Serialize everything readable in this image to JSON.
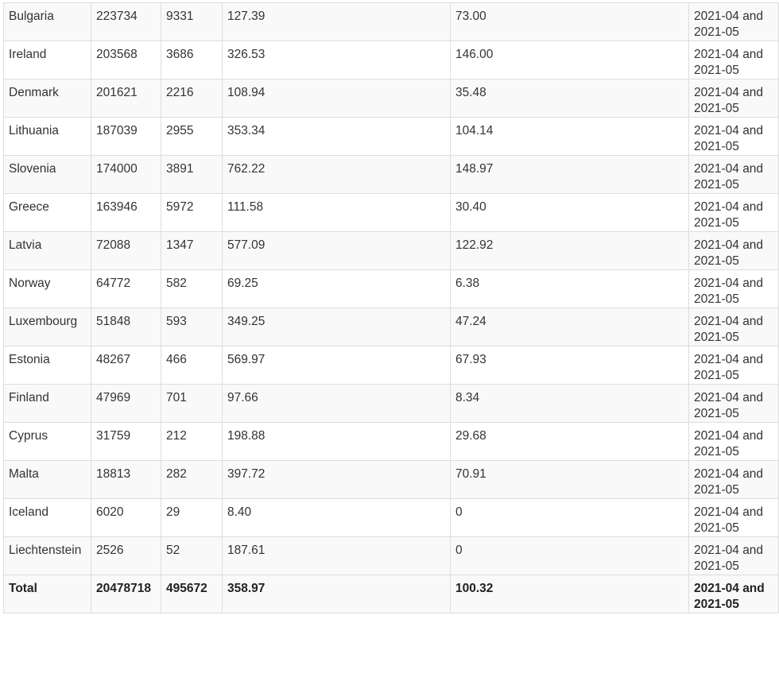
{
  "table": {
    "rows": [
      [
        "Bulgaria",
        "223734",
        "9331",
        "127.39",
        "73.00",
        "2021-04 and 2021-05"
      ],
      [
        "Ireland",
        "203568",
        "3686",
        "326.53",
        "146.00",
        "2021-04 and 2021-05"
      ],
      [
        "Denmark",
        "201621",
        "2216",
        "108.94",
        "35.48",
        "2021-04 and 2021-05"
      ],
      [
        "Lithuania",
        "187039",
        "2955",
        "353.34",
        "104.14",
        "2021-04 and 2021-05"
      ],
      [
        "Slovenia",
        "174000",
        "3891",
        "762.22",
        "148.97",
        "2021-04 and 2021-05"
      ],
      [
        "Greece",
        "163946",
        "5972",
        "111.58",
        "30.40",
        "2021-04 and 2021-05"
      ],
      [
        "Latvia",
        "72088",
        "1347",
        "577.09",
        "122.92",
        "2021-04 and 2021-05"
      ],
      [
        "Norway",
        "64772",
        "582",
        "69.25",
        "6.38",
        "2021-04 and 2021-05"
      ],
      [
        "Luxembourg",
        "51848",
        "593",
        "349.25",
        "47.24",
        "2021-04 and 2021-05"
      ],
      [
        "Estonia",
        "48267",
        "466",
        "569.97",
        "67.93",
        "2021-04 and 2021-05"
      ],
      [
        "Finland",
        "47969",
        "701",
        "97.66",
        "8.34",
        "2021-04 and 2021-05"
      ],
      [
        "Cyprus",
        "31759",
        "212",
        "198.88",
        "29.68",
        "2021-04 and 2021-05"
      ],
      [
        "Malta",
        "18813",
        "282",
        "397.72",
        "70.91",
        "2021-04 and 2021-05"
      ],
      [
        "Iceland",
        "6020",
        "29",
        "8.40",
        "0",
        "2021-04 and 2021-05"
      ],
      [
        "Liechtenstein",
        "2526",
        "52",
        "187.61",
        "0",
        "2021-04 and 2021-05"
      ]
    ],
    "total": [
      "Total",
      "20478718",
      "495672",
      "358.97",
      "100.32",
      "2021-04 and 2021-05"
    ]
  }
}
